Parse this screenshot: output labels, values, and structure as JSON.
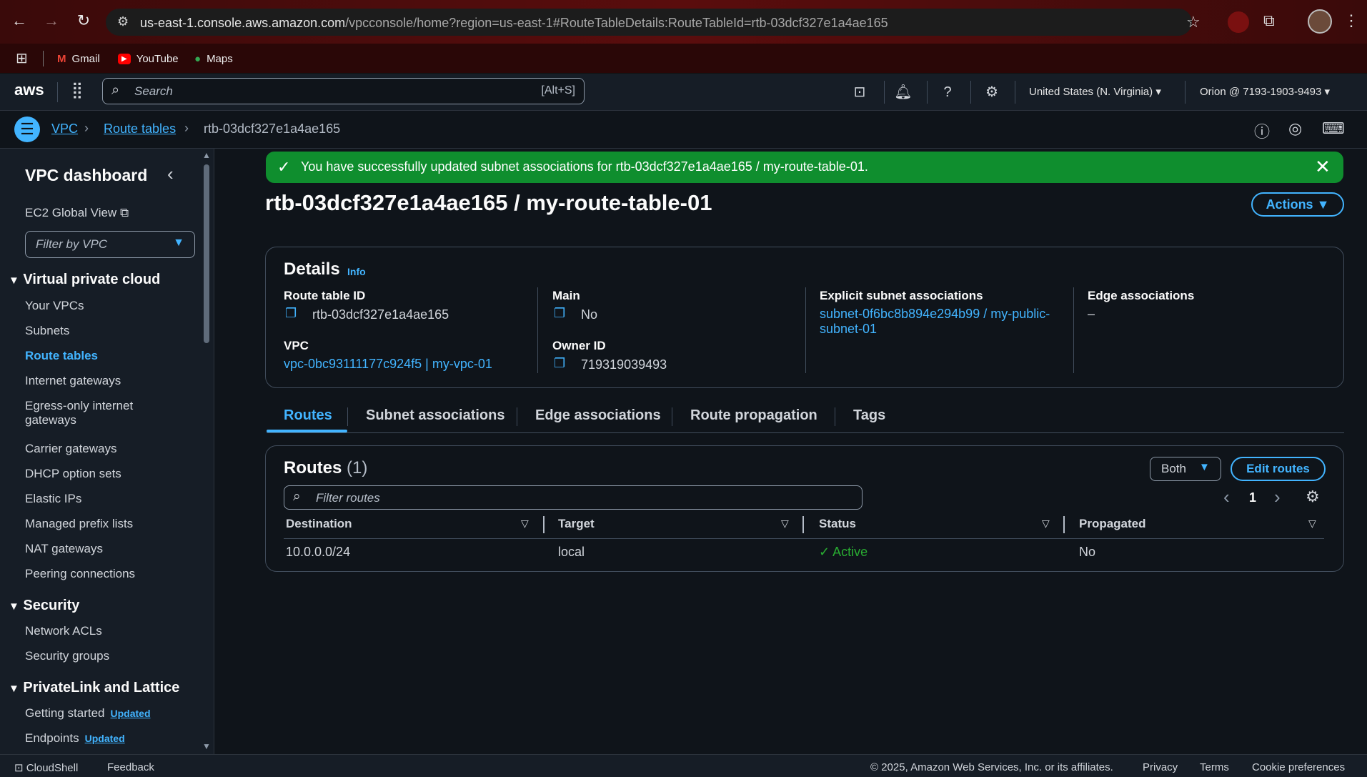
{
  "browser": {
    "url_host": "us-east-1.console.aws.amazon.com",
    "url_path": "/vpcconsole/home?region=us-east-1#RouteTableDetails:RouteTableId=rtb-03dcf327e1a4ae165",
    "bookmarks": [
      "Gmail",
      "YouTube",
      "Maps"
    ]
  },
  "aws_header": {
    "logo": "aws",
    "search_placeholder": "Search",
    "search_shortcut": "[Alt+S]",
    "region": "United States (N. Virginia)",
    "account": "Orion @ 7193-1903-9493"
  },
  "breadcrumb": {
    "items": [
      "VPC",
      "Route tables"
    ],
    "current": "rtb-03dcf327e1a4ae165"
  },
  "sidebar": {
    "title": "VPC dashboard",
    "ec2_global_view": "EC2 Global View",
    "filter_placeholder": "Filter by VPC",
    "sections": [
      {
        "title": "Virtual private cloud",
        "items": [
          "Your VPCs",
          "Subnets",
          "Route tables",
          "Internet gateways",
          "Egress-only internet",
          "gateways",
          "Carrier gateways",
          "DHCP option sets",
          "Elastic IPs",
          "Managed prefix lists",
          "NAT gateways",
          "Peering connections"
        ]
      },
      {
        "title": "Security",
        "items": [
          "Network ACLs",
          "Security groups"
        ]
      },
      {
        "title": "PrivateLink and Lattice",
        "items": [
          "Getting started",
          "Endpoints"
        ]
      }
    ],
    "badge": "Updated",
    "active_item": "Route tables"
  },
  "flash": {
    "message": "You have successfully updated subnet associations for rtb-03dcf327e1a4ae165 / my-route-table-01."
  },
  "page": {
    "title": "rtb-03dcf327e1a4ae165 / my-route-table-01",
    "actions_label": "Actions"
  },
  "details": {
    "heading": "Details",
    "info": "Info",
    "route_table_id_label": "Route table ID",
    "route_table_id": "rtb-03dcf327e1a4ae165",
    "vpc_label": "VPC",
    "vpc": "vpc-0bc93111177c924f5 | my-vpc-01",
    "main_label": "Main",
    "main": "No",
    "owner_label": "Owner ID",
    "owner": "719319039493",
    "explicit_label": "Explicit subnet associations",
    "explicit_line1": "subnet-0f6bc8b894e294b99 / my-public-",
    "explicit_line2": "subnet-01",
    "edge_label": "Edge associations",
    "edge": "–"
  },
  "tabs": [
    "Routes",
    "Subnet associations",
    "Edge associations",
    "Route propagation",
    "Tags"
  ],
  "routes": {
    "heading": "Routes",
    "count": "(1)",
    "filter_placeholder": "Filter routes",
    "both_label": "Both",
    "edit_label": "Edit routes",
    "page": "1",
    "columns": [
      "Destination",
      "Target",
      "Status",
      "Propagated"
    ],
    "rows": [
      {
        "destination": "10.0.0.0/24",
        "target": "local",
        "status": "Active",
        "propagated": "No"
      }
    ]
  },
  "footer": {
    "cloudshell": "CloudShell",
    "feedback": "Feedback",
    "copyright": "© 2025, Amazon Web Services, Inc. or its affiliates.",
    "privacy": "Privacy",
    "terms": "Terms",
    "cookies": "Cookie preferences"
  },
  "colors": {
    "link": "#42b4ff",
    "success": "#0f8e2e",
    "status_ok": "#29ad32"
  }
}
